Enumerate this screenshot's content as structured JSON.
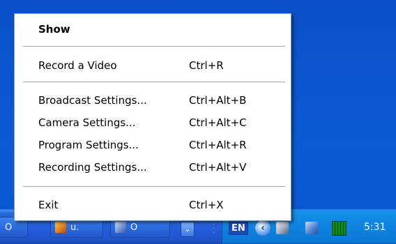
{
  "menu": {
    "items": [
      {
        "label": "Show",
        "shortcut": ""
      },
      {
        "label": "Record a Video",
        "shortcut": "Ctrl+R"
      },
      {
        "label": "Broadcast Settings...",
        "shortcut": "Ctrl+Alt+B"
      },
      {
        "label": "Camera Settings...",
        "shortcut": "Ctrl+Alt+C"
      },
      {
        "label": "Program Settings...",
        "shortcut": "Ctrl+Alt+R"
      },
      {
        "label": "Recording Settings...",
        "shortcut": "Ctrl+Alt+V"
      },
      {
        "label": "Exit",
        "shortcut": "Ctrl+X"
      }
    ]
  },
  "taskbar": {
    "buttons": [
      {
        "label": "O"
      },
      {
        "label": "u.",
        "icon": "winamp-icon"
      },
      {
        "label": "O",
        "icon": "app-icon"
      }
    ],
    "show_more_glyph": "⌄"
  },
  "tray": {
    "language": "EN",
    "arrow_glyph": "‹",
    "icons": [
      "camera-icon",
      "network-icon",
      "meter-icon"
    ],
    "clock": "5:31"
  },
  "colors": {
    "desktop": "#0a56cc",
    "taskbar": "#245edb",
    "tray": "#0f86e2",
    "menu_bg": "#ffffff"
  }
}
